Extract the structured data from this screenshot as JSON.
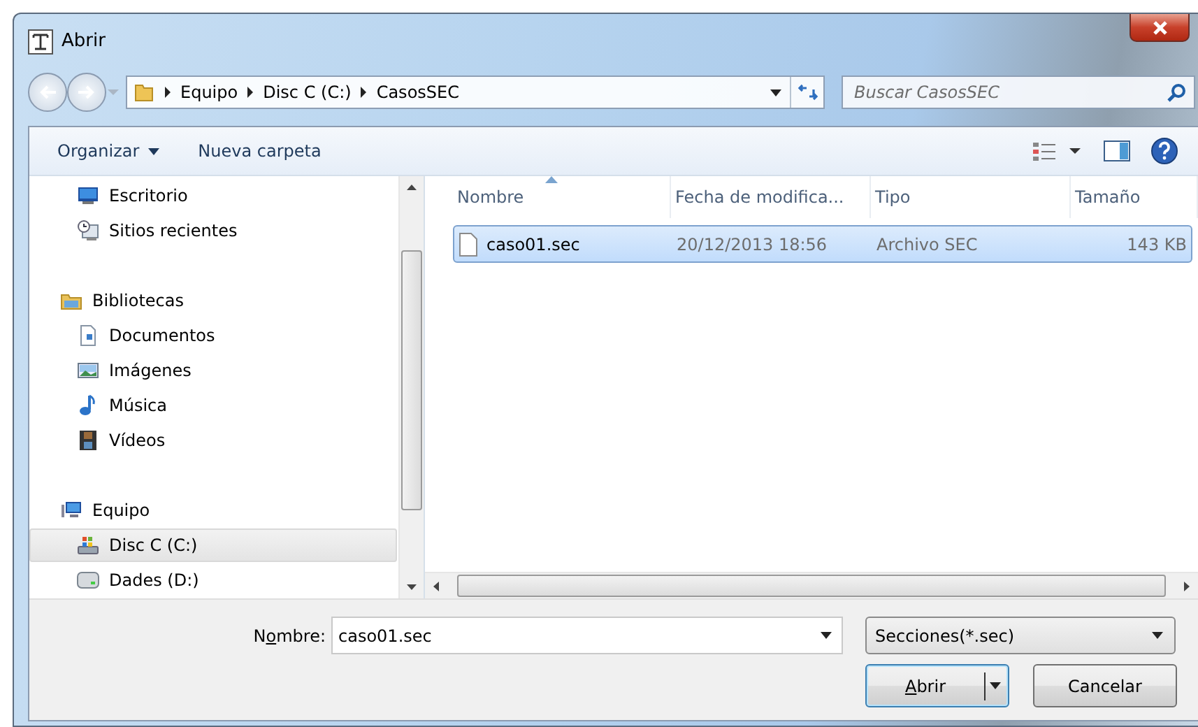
{
  "window": {
    "title": "Abrir"
  },
  "navigation": {
    "path": [
      "Equipo",
      "Disc C (C:)",
      "CasosSEC"
    ],
    "search": {
      "placeholder": "Buscar CasosSEC"
    }
  },
  "toolbar": {
    "buttons": [
      {
        "label": "Organizar",
        "kind": "menu"
      },
      {
        "label": "Nueva carpeta",
        "kind": "plain"
      }
    ]
  },
  "sidebar": {
    "items": [
      {
        "children": [
          {
            "label": "Escritorio",
            "kind": "desktop",
            "selected": false
          },
          {
            "label": "Sitios recientes",
            "kind": "recent",
            "selected": false
          }
        ]
      },
      {
        "label": "Bibliotecas",
        "kind": "library",
        "children": [
          {
            "label": "Documentos",
            "kind": "documents",
            "selected": false
          },
          {
            "label": "Imágenes",
            "kind": "images",
            "selected": false
          },
          {
            "label": "Música",
            "kind": "music",
            "selected": false
          },
          {
            "label": "Vídeos",
            "kind": "videos",
            "selected": false
          }
        ]
      },
      {
        "label": "Equipo",
        "kind": "computer",
        "children": [
          {
            "label": "Disc C (C:)",
            "kind": "system-drive",
            "selected": true
          },
          {
            "label": "Dades (D:)",
            "kind": "drive",
            "selected": false
          }
        ]
      }
    ]
  },
  "file_list": {
    "columns": [
      {
        "label": "Nombre",
        "sorted": true
      },
      {
        "label": "Fecha de modifica...",
        "sorted": false
      },
      {
        "label": "Tipo",
        "sorted": false
      },
      {
        "label": "Tamaño",
        "sorted": false
      }
    ],
    "rows": [
      {
        "cells": [
          "caso01.sec",
          "20/12/2013 18:56",
          "Archivo SEC",
          "143 KB"
        ],
        "selected": true
      }
    ]
  },
  "footer": {
    "filename": {
      "label": {
        "before": "N",
        "key": "o",
        "after": "mbre:"
      },
      "value": "caso01.sec"
    },
    "filter": {
      "value": "Secciones(*.sec)"
    },
    "buttons": [
      {
        "label": {
          "key": "A",
          "after": "brir"
        },
        "kind": "split"
      },
      {
        "label": {
          "before": "Cancelar"
        },
        "kind": "plain"
      }
    ]
  }
}
